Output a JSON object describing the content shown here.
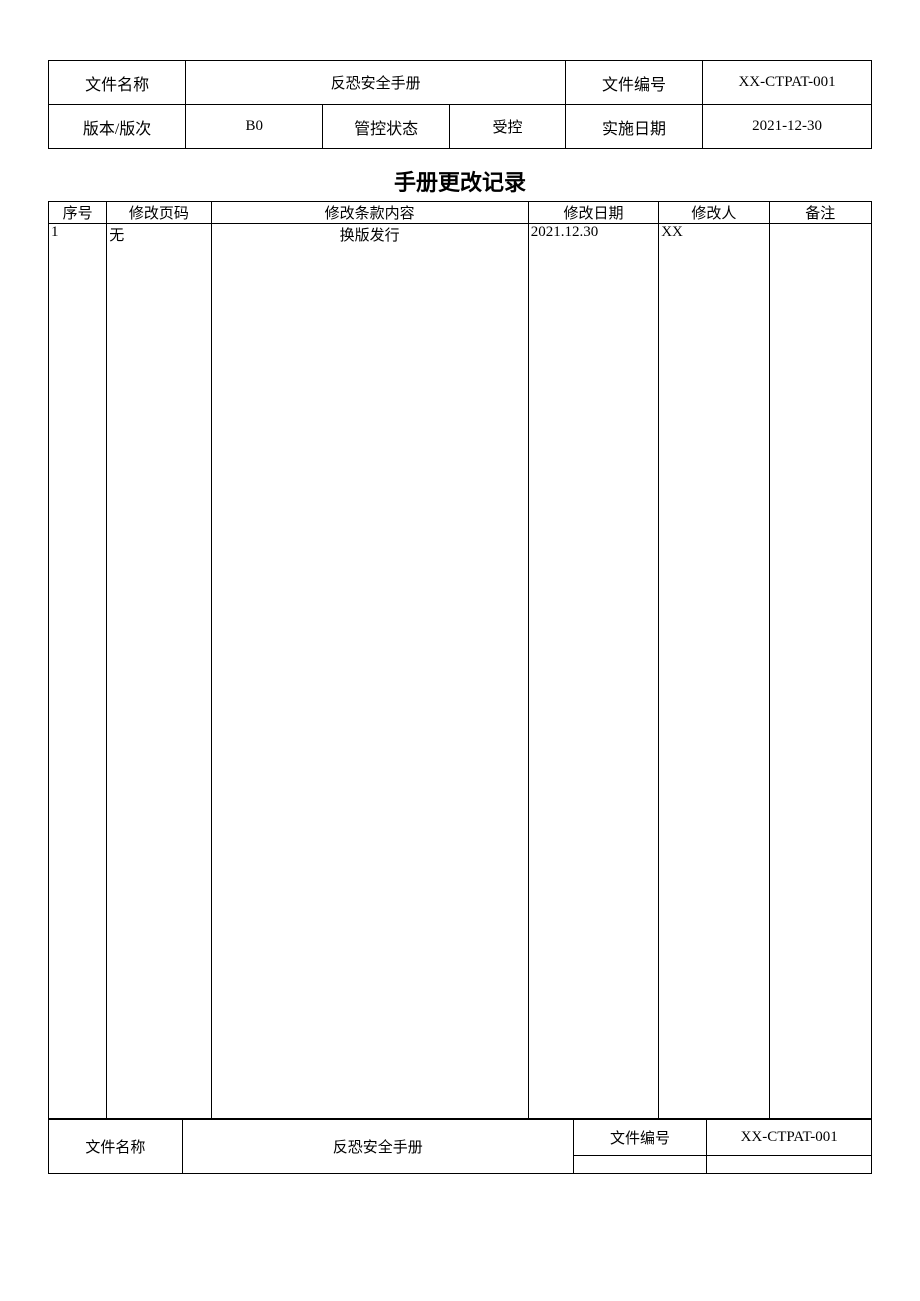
{
  "header": {
    "file_name_label": "文件名称",
    "file_name_value": "反恐安全手册",
    "file_no_label": "文件编号",
    "file_no_value": "XX-CTPAT-001",
    "version_label": "版本/版次",
    "version_value": "B0",
    "control_status_label": "管控状态",
    "control_status_value": "受控",
    "impl_date_label": "实施日期",
    "impl_date_value": "2021-12-30"
  },
  "section_title": "手册更改记录",
  "record_th": {
    "seq": "序号",
    "page": "修改页码",
    "content": "修改条款内容",
    "date": "修改日期",
    "person": "修改人",
    "remark": "备注"
  },
  "records": [
    {
      "seq": "1",
      "page": "无",
      "content": "换版发行",
      "date": "2021.12.30",
      "person": "XX",
      "remark": ""
    }
  ],
  "footer": {
    "file_name_label": "文件名称",
    "file_name_value": "反恐安全手册",
    "file_no_label": "文件编号",
    "file_no_value": "XX-CTPAT-001"
  }
}
